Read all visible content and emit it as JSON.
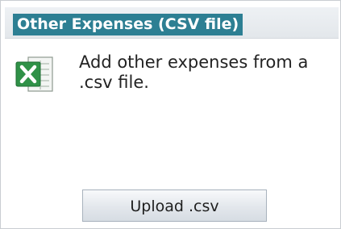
{
  "panel": {
    "title": "Other Expenses (CSV file)",
    "description": "Add other expenses from a .csv file.",
    "icon": "excel-icon",
    "upload_label": "Upload .csv"
  },
  "colors": {
    "title_background": "#2d7f93",
    "title_text": "#ffffff",
    "header_background": "#e8ebef",
    "icon_green": "#2f9147"
  }
}
